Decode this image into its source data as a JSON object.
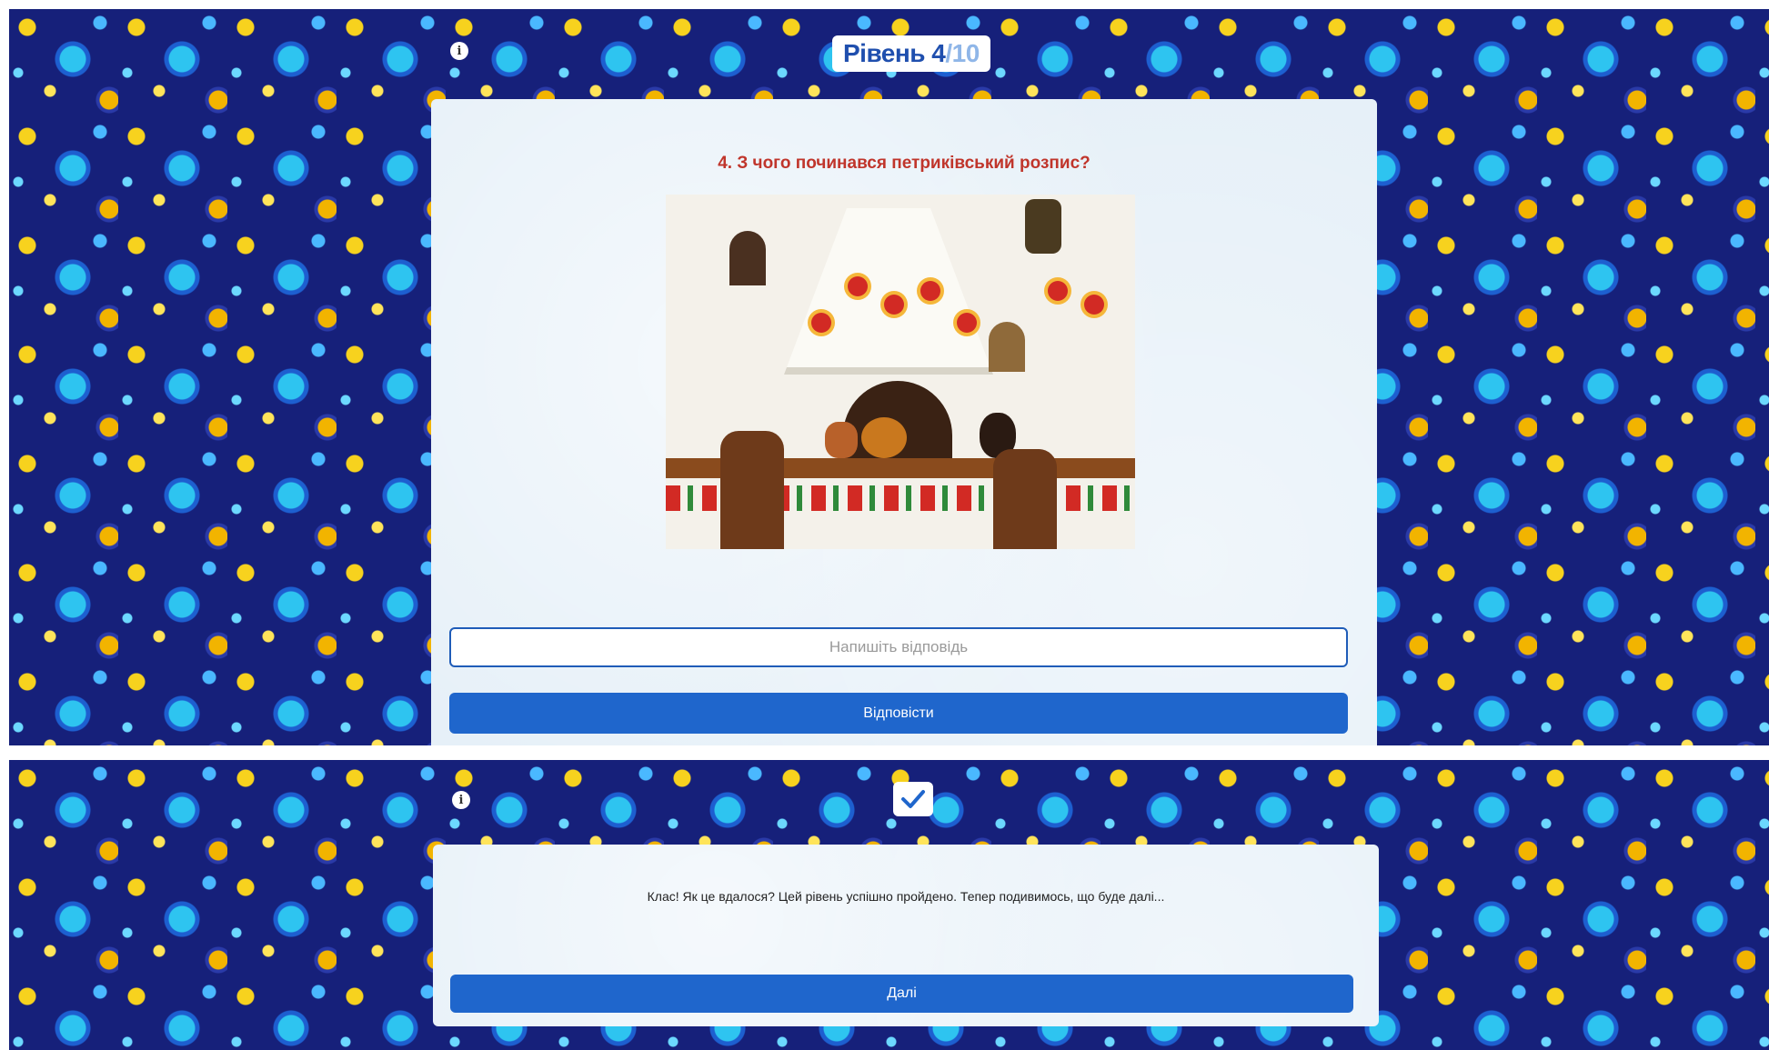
{
  "quiz": {
    "level_current": "Рівень 4",
    "level_total": "/10",
    "question": "4. З чого починався петриківський розпис?",
    "image_alt": "Розписана петриківським розписом піч",
    "answer_placeholder": "Напишіть відповідь",
    "answer_value": "",
    "answer_button": "Відповісти"
  },
  "result": {
    "message": "Клас! Як це вдалося? Цей рівень успішно пройдено. Тепер подивимось, що буде далі...",
    "next_button": "Далі"
  },
  "icons": {
    "info": "info-icon",
    "check": "checkmark-icon"
  },
  "colors": {
    "accent_blue": "#1f66cc",
    "question_red": "#c0352b",
    "level_blue": "#1f4fae"
  }
}
